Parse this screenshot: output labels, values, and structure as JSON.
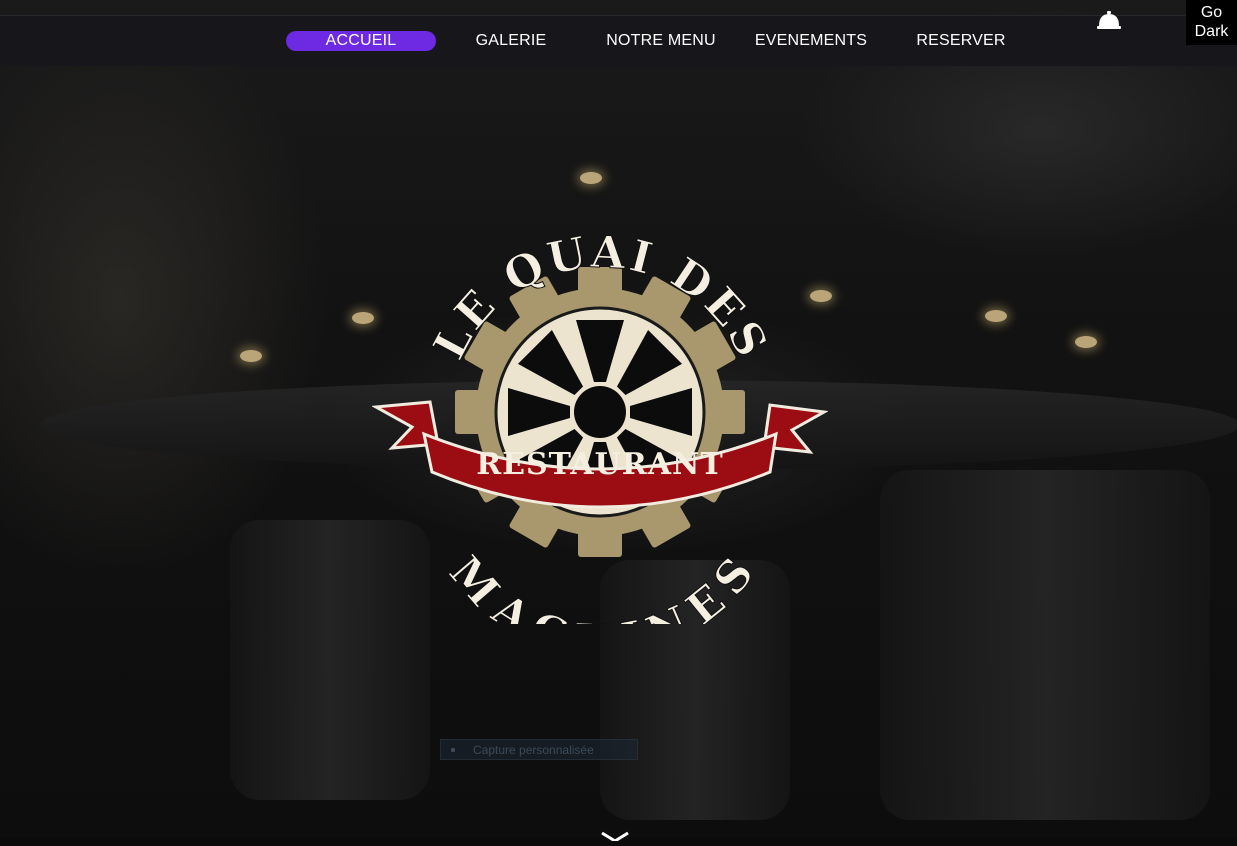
{
  "nav": {
    "items": [
      {
        "label": "ACCUEIL",
        "active": true
      },
      {
        "label": "GALERIE",
        "active": false
      },
      {
        "label": "NOTRE MENU",
        "active": false
      },
      {
        "label": "EVENEMENTS",
        "active": false
      },
      {
        "label": "RESERVER",
        "active": false
      }
    ],
    "active_color": "#6d2ae2",
    "bell_icon": "service-bell-icon"
  },
  "theme_toggle": {
    "line1": "Go",
    "line2": "Dark"
  },
  "logo": {
    "top_text": "LE QUAI DES",
    "banner_text": "RESTAURANT",
    "bottom_text": "MACHINES",
    "gear_color": "#a9986d",
    "wheel_color": "#ece4cf",
    "banner_color": "#9b0d12"
  },
  "hidden_field": {
    "text": "Capture personnalisée"
  },
  "scroll_icon": "chevron-down-icon"
}
